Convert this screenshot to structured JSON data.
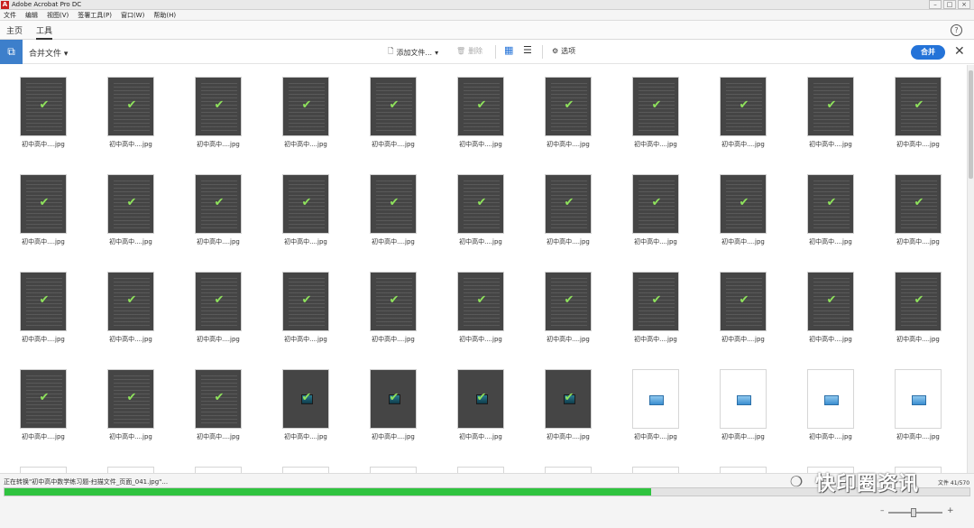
{
  "window": {
    "title": "Adobe Acrobat Pro DC",
    "icon": "acrobat-logo"
  },
  "menu": [
    "文件",
    "编辑",
    "视图(V)",
    "签署工具(P)",
    "窗口(W)",
    "帮助(H)"
  ],
  "tabs": [
    "主页",
    "工具"
  ],
  "toolbar": {
    "combine_files": "合并文件",
    "add_files": "添加文件...",
    "delete": "删除",
    "options": "选项",
    "merge": "合并"
  },
  "grid": {
    "thumb_label": "初中高中....jpg",
    "rows": [
      [
        "doc",
        "doc",
        "doc",
        "doc",
        "doc",
        "doc",
        "doc",
        "doc",
        "doc",
        "doc",
        "doc"
      ],
      [
        "doc",
        "doc",
        "doc",
        "doc",
        "doc",
        "doc",
        "doc",
        "doc",
        "doc",
        "doc",
        "doc"
      ],
      [
        "doc",
        "doc",
        "doc",
        "doc",
        "doc",
        "doc",
        "doc",
        "doc",
        "doc",
        "doc",
        "doc"
      ],
      [
        "doc",
        "doc",
        "doc",
        "img-dark",
        "img-dark",
        "img-dark",
        "img-dark",
        "img-light",
        "img-light",
        "img-light",
        "img-light"
      ]
    ]
  },
  "status": {
    "text": "正在转换\"初中高中数学练习题-扫描文件_页面_041.jpg\"...",
    "file_count": "文件 41/570",
    "progress_fraction": 0.67
  },
  "brand": {
    "logo": "wechat-icon",
    "text": "快印圈资讯"
  },
  "colors": {
    "accent": "#2473d8",
    "progress": "#2fc33f",
    "check": "#8fe35c"
  }
}
